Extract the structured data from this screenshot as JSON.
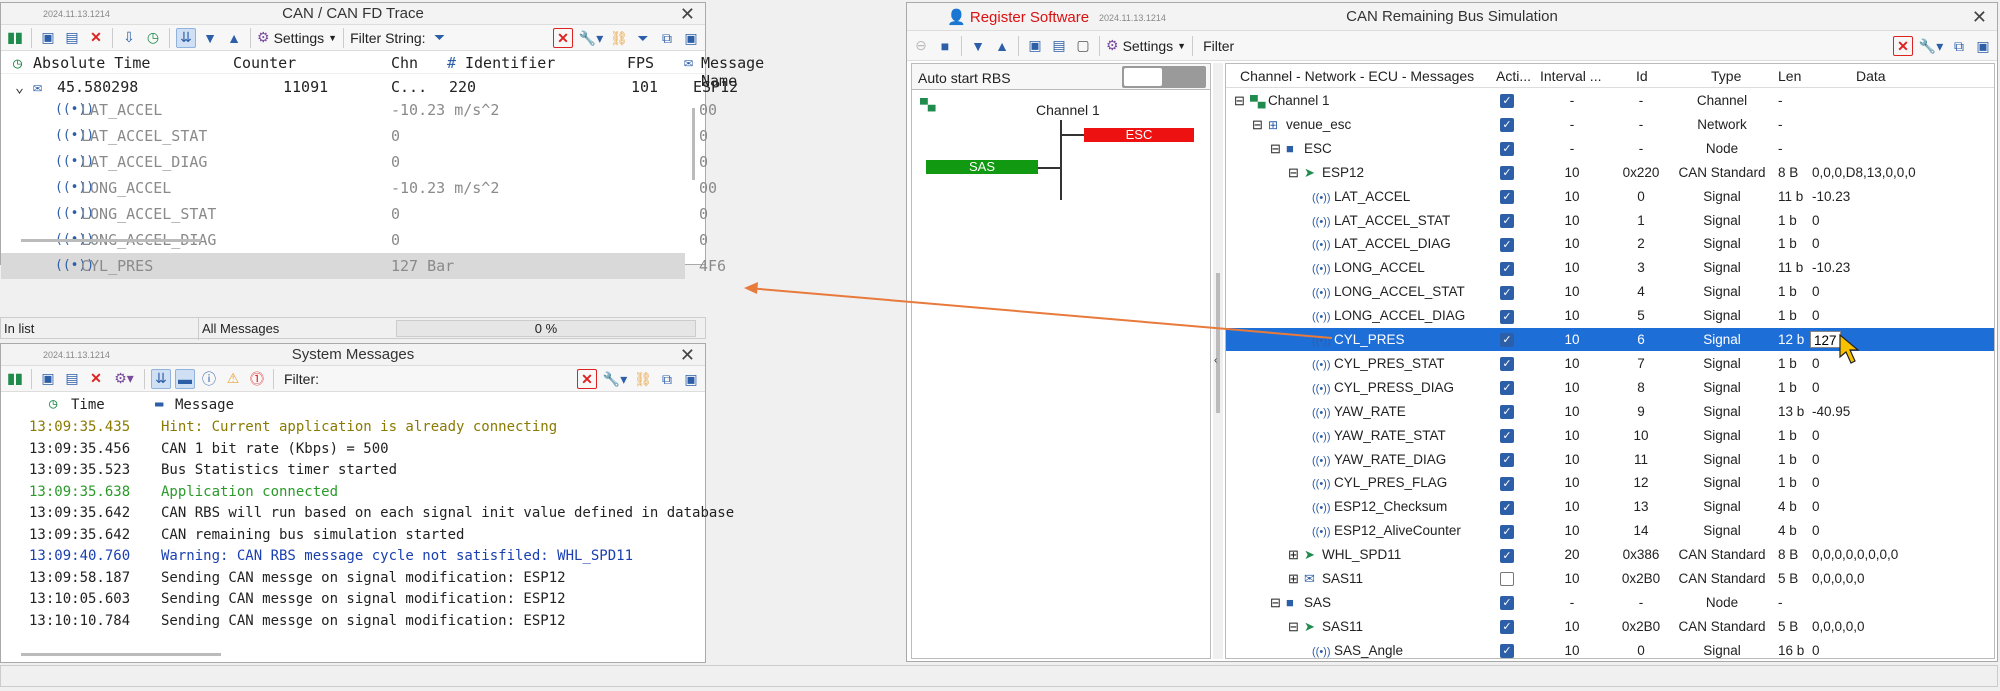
{
  "trace": {
    "title": "CAN / CAN FD Trace",
    "version": "2024.11.13.1214",
    "settings_label": "Settings",
    "filter_label": "Filter String:",
    "headers": {
      "time": "Absolute Time",
      "counter": "Counter",
      "chn": "Chn",
      "identifier": "Identifier",
      "fps": "FPS",
      "message": "Message Name"
    },
    "message": {
      "time": "45.580298",
      "counter": "11091",
      "chn": "C...",
      "identifier": "220",
      "fps": "101",
      "name": "ESP12"
    },
    "signals": [
      {
        "name": "LAT_ACCEL",
        "value": "-10.23 m/s^2",
        "raw": "00"
      },
      {
        "name": "LAT_ACCEL_STAT",
        "value": "0",
        "raw": "0"
      },
      {
        "name": "LAT_ACCEL_DIAG",
        "value": "0",
        "raw": "0"
      },
      {
        "name": "LONG_ACCEL",
        "value": "-10.23 m/s^2",
        "raw": "00"
      },
      {
        "name": "LONG_ACCEL_STAT",
        "value": "0",
        "raw": "0"
      },
      {
        "name": "LONG_ACCEL_DIAG",
        "value": "0",
        "raw": "0"
      },
      {
        "name": "CYL_PRES",
        "value": "127 Bar",
        "raw": "4F6"
      }
    ],
    "status": {
      "left": "In list",
      "mid": "All Messages",
      "progress": "0 %"
    }
  },
  "system": {
    "title": "System Messages",
    "version": "2024.11.13.1214",
    "filter_label": "Filter:",
    "headers": {
      "time": "Time",
      "message": "Message"
    },
    "messages": [
      {
        "time": "13:09:35.435",
        "text": "Hint: Current application is already connecting",
        "kind": "hint"
      },
      {
        "time": "13:09:35.456",
        "text": "CAN 1 bit rate (Kbps) = 500",
        "kind": "info"
      },
      {
        "time": "13:09:35.523",
        "text": "Bus Statistics timer started",
        "kind": "info"
      },
      {
        "time": "13:09:35.638",
        "text": "Application connected",
        "kind": "ok"
      },
      {
        "time": "13:09:35.642",
        "text": "CAN RBS will run based on each signal init value defined in database",
        "kind": "info"
      },
      {
        "time": "13:09:35.642",
        "text": "CAN remaining bus simulation started",
        "kind": "info"
      },
      {
        "time": "13:09:40.760",
        "text": "Warning: CAN RBS message cycle not satisfiled: WHL_SPD11",
        "kind": "warn"
      },
      {
        "time": "13:09:58.187",
        "text": "Sending CAN messge on signal modification: ESP12",
        "kind": "info"
      },
      {
        "time": "13:10:05.603",
        "text": "Sending CAN messge on signal modification: ESP12",
        "kind": "info"
      },
      {
        "time": "13:10:10.784",
        "text": "Sending CAN messge on signal modification: ESP12",
        "kind": "info"
      }
    ]
  },
  "rbs": {
    "title": "CAN Remaining Bus Simulation",
    "register_label": "Register Software",
    "version": "2024.11.13.1214",
    "settings_label": "Settings",
    "filter_label": "Filter",
    "auto_start_label": "Auto start RBS",
    "channel_label": "Channel 1",
    "esc_label": "ESC",
    "sas_label": "SAS",
    "headers": {
      "tree": "Channel - Network - ECU - Messages",
      "active": "Acti...",
      "interval": "Interval ...",
      "id": "Id",
      "type": "Type",
      "len": "Len",
      "data": "Data"
    },
    "rows": [
      {
        "level": 0,
        "toggle": "⊟",
        "icon": "channel",
        "name": "Channel 1",
        "check": true,
        "interval": "-",
        "id": "-",
        "type": "Channel",
        "len": "-",
        "data": ""
      },
      {
        "level": 1,
        "toggle": "⊟",
        "icon": "network",
        "name": "venue_esc",
        "check": true,
        "interval": "-",
        "id": "-",
        "type": "Network",
        "len": "-",
        "data": ""
      },
      {
        "level": 2,
        "toggle": "⊟",
        "icon": "node",
        "name": "ESC",
        "check": true,
        "interval": "-",
        "id": "-",
        "type": "Node",
        "len": "-",
        "data": ""
      },
      {
        "level": 3,
        "toggle": "⊟",
        "icon": "tx-msg",
        "name": "ESP12",
        "check": true,
        "interval": "10",
        "id": "0x220",
        "type": "CAN Standard",
        "len": "8 B",
        "data": "0,0,0,D8,13,0,0,0"
      },
      {
        "level": 4,
        "toggle": "",
        "icon": "signal",
        "name": "LAT_ACCEL",
        "check": true,
        "interval": "10",
        "id": "0",
        "type": "Signal",
        "len": "11 b",
        "data": "-10.23"
      },
      {
        "level": 4,
        "toggle": "",
        "icon": "signal",
        "name": "LAT_ACCEL_STAT",
        "check": true,
        "interval": "10",
        "id": "1",
        "type": "Signal",
        "len": "1 b",
        "data": "0"
      },
      {
        "level": 4,
        "toggle": "",
        "icon": "signal",
        "name": "LAT_ACCEL_DIAG",
        "check": true,
        "interval": "10",
        "id": "2",
        "type": "Signal",
        "len": "1 b",
        "data": "0"
      },
      {
        "level": 4,
        "toggle": "",
        "icon": "signal",
        "name": "LONG_ACCEL",
        "check": true,
        "interval": "10",
        "id": "3",
        "type": "Signal",
        "len": "11 b",
        "data": "-10.23"
      },
      {
        "level": 4,
        "toggle": "",
        "icon": "signal",
        "name": "LONG_ACCEL_STAT",
        "check": true,
        "interval": "10",
        "id": "4",
        "type": "Signal",
        "len": "1 b",
        "data": "0"
      },
      {
        "level": 4,
        "toggle": "",
        "icon": "signal",
        "name": "LONG_ACCEL_DIAG",
        "check": true,
        "interval": "10",
        "id": "5",
        "type": "Signal",
        "len": "1 b",
        "data": "0"
      },
      {
        "level": 4,
        "toggle": "",
        "icon": "signal",
        "name": "CYL_PRES",
        "check": true,
        "interval": "10",
        "id": "6",
        "type": "Signal",
        "len": "12 b",
        "data": "127",
        "selected": true
      },
      {
        "level": 4,
        "toggle": "",
        "icon": "signal",
        "name": "CYL_PRES_STAT",
        "check": true,
        "interval": "10",
        "id": "7",
        "type": "Signal",
        "len": "1 b",
        "data": "0"
      },
      {
        "level": 4,
        "toggle": "",
        "icon": "signal",
        "name": "CYL_PRESS_DIAG",
        "check": true,
        "interval": "10",
        "id": "8",
        "type": "Signal",
        "len": "1 b",
        "data": "0"
      },
      {
        "level": 4,
        "toggle": "",
        "icon": "signal",
        "name": "YAW_RATE",
        "check": true,
        "interval": "10",
        "id": "9",
        "type": "Signal",
        "len": "13 b",
        "data": "-40.95"
      },
      {
        "level": 4,
        "toggle": "",
        "icon": "signal",
        "name": "YAW_RATE_STAT",
        "check": true,
        "interval": "10",
        "id": "10",
        "type": "Signal",
        "len": "1 b",
        "data": "0"
      },
      {
        "level": 4,
        "toggle": "",
        "icon": "signal",
        "name": "YAW_RATE_DIAG",
        "check": true,
        "interval": "10",
        "id": "11",
        "type": "Signal",
        "len": "1 b",
        "data": "0"
      },
      {
        "level": 4,
        "toggle": "",
        "icon": "signal",
        "name": "CYL_PRES_FLAG",
        "check": true,
        "interval": "10",
        "id": "12",
        "type": "Signal",
        "len": "1 b",
        "data": "0"
      },
      {
        "level": 4,
        "toggle": "",
        "icon": "signal",
        "name": "ESP12_Checksum",
        "check": true,
        "interval": "10",
        "id": "13",
        "type": "Signal",
        "len": "4 b",
        "data": "0"
      },
      {
        "level": 4,
        "toggle": "",
        "icon": "signal",
        "name": "ESP12_AliveCounter",
        "check": true,
        "interval": "10",
        "id": "14",
        "type": "Signal",
        "len": "4 b",
        "data": "0"
      },
      {
        "level": 3,
        "toggle": "⊞",
        "icon": "tx-msg",
        "name": "WHL_SPD11",
        "check": true,
        "interval": "20",
        "id": "0x386",
        "type": "CAN Standard",
        "len": "8 B",
        "data": "0,0,0,0,0,0,0,0"
      },
      {
        "level": 3,
        "toggle": "⊞",
        "icon": "rx-msg",
        "name": "SAS11",
        "check": false,
        "interval": "10",
        "id": "0x2B0",
        "type": "CAN Standard",
        "len": "5 B",
        "data": "0,0,0,0,0"
      },
      {
        "level": 2,
        "toggle": "⊟",
        "icon": "node",
        "name": "SAS",
        "check": true,
        "interval": "-",
        "id": "-",
        "type": "Node",
        "len": "-",
        "data": ""
      },
      {
        "level": 3,
        "toggle": "⊟",
        "icon": "tx-msg",
        "name": "SAS11",
        "check": true,
        "interval": "10",
        "id": "0x2B0",
        "type": "CAN Standard",
        "len": "5 B",
        "data": "0,0,0,0,0"
      },
      {
        "level": 4,
        "toggle": "",
        "icon": "signal",
        "name": "SAS_Angle",
        "check": true,
        "interval": "10",
        "id": "0",
        "type": "Signal",
        "len": "16 b",
        "data": "0"
      }
    ]
  },
  "colors": {
    "accent": "#2d5ea8",
    "selection": "#1e6ed8",
    "esc": "#ee1111",
    "sas": "#119911",
    "arrow": "#e87a3c",
    "hint": "#8a7a00",
    "ok": "#2a9a2a",
    "warn": "#1a3fb0"
  }
}
